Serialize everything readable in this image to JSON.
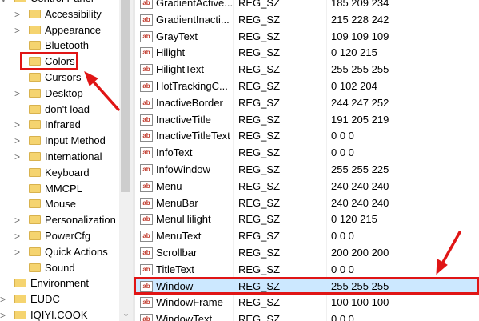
{
  "tree": {
    "items": [
      {
        "label": "Control Panel",
        "expander": "∨"
      },
      {
        "label": "Accessibility",
        "expander": ">"
      },
      {
        "label": "Appearance",
        "expander": ">"
      },
      {
        "label": "Bluetooth",
        "expander": ""
      },
      {
        "label": "Colors",
        "expander": ""
      },
      {
        "label": "Cursors",
        "expander": ""
      },
      {
        "label": "Desktop",
        "expander": ">"
      },
      {
        "label": "don't load",
        "expander": ""
      },
      {
        "label": "Infrared",
        "expander": ">"
      },
      {
        "label": "Input Method",
        "expander": ">"
      },
      {
        "label": "International",
        "expander": ">"
      },
      {
        "label": "Keyboard",
        "expander": ""
      },
      {
        "label": "MMCPL",
        "expander": ""
      },
      {
        "label": "Mouse",
        "expander": ""
      },
      {
        "label": "Personalization",
        "expander": ">"
      },
      {
        "label": "PowerCfg",
        "expander": ">"
      },
      {
        "label": "Quick Actions",
        "expander": ">"
      },
      {
        "label": "Sound",
        "expander": ""
      },
      {
        "label": "Environment",
        "expander": ""
      },
      {
        "label": "EUDC",
        "expander": ">"
      },
      {
        "label": "IQIYI.COOK",
        "expander": ">"
      }
    ],
    "selected": "Colors",
    "scroll_down_icon": "chevron-down-icon"
  },
  "values": {
    "icon_text": "ab",
    "rows": [
      {
        "name": "GradientActive...",
        "type": "REG_SZ",
        "data": "185 209 234"
      },
      {
        "name": "GradientInacti...",
        "type": "REG_SZ",
        "data": "215 228 242"
      },
      {
        "name": "GrayText",
        "type": "REG_SZ",
        "data": "109 109 109"
      },
      {
        "name": "Hilight",
        "type": "REG_SZ",
        "data": "0 120 215"
      },
      {
        "name": "HilightText",
        "type": "REG_SZ",
        "data": "255 255 255"
      },
      {
        "name": "HotTrackingC...",
        "type": "REG_SZ",
        "data": "0 102 204"
      },
      {
        "name": "InactiveBorder",
        "type": "REG_SZ",
        "data": "244 247 252"
      },
      {
        "name": "InactiveTitle",
        "type": "REG_SZ",
        "data": "191 205 219"
      },
      {
        "name": "InactiveTitleText",
        "type": "REG_SZ",
        "data": "0 0 0"
      },
      {
        "name": "InfoText",
        "type": "REG_SZ",
        "data": "0 0 0"
      },
      {
        "name": "InfoWindow",
        "type": "REG_SZ",
        "data": "255 255 225"
      },
      {
        "name": "Menu",
        "type": "REG_SZ",
        "data": "240 240 240"
      },
      {
        "name": "MenuBar",
        "type": "REG_SZ",
        "data": "240 240 240"
      },
      {
        "name": "MenuHilight",
        "type": "REG_SZ",
        "data": "0 120 215"
      },
      {
        "name": "MenuText",
        "type": "REG_SZ",
        "data": "0 0 0"
      },
      {
        "name": "Scrollbar",
        "type": "REG_SZ",
        "data": "200 200 200"
      },
      {
        "name": "TitleText",
        "type": "REG_SZ",
        "data": "0 0 0"
      },
      {
        "name": "Window",
        "type": "REG_SZ",
        "data": "255 255 255"
      },
      {
        "name": "WindowFrame",
        "type": "REG_SZ",
        "data": "100 100 100"
      },
      {
        "name": "WindowText",
        "type": "REG_SZ",
        "data": "0 0 0"
      }
    ],
    "selected": "Window"
  },
  "annotation": {
    "color": "#e01515"
  }
}
